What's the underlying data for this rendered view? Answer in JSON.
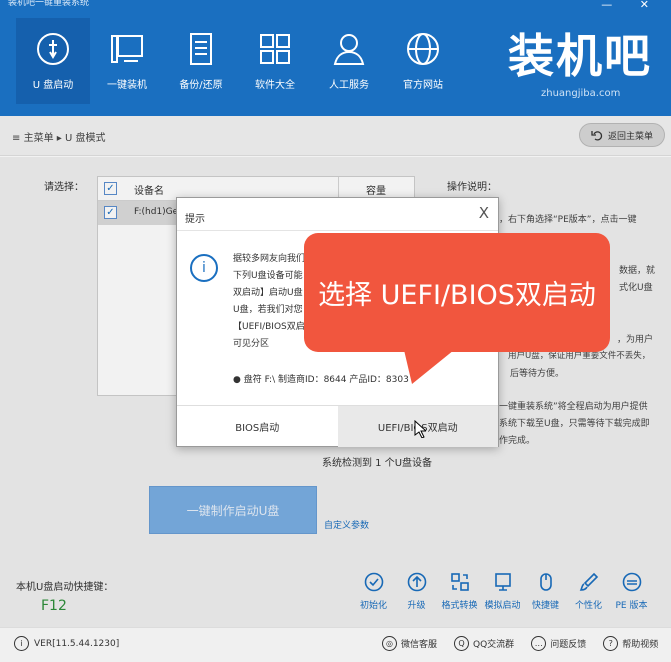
{
  "window": {
    "title": "装机吧一键重装系统",
    "controls": "— ✕"
  },
  "nav": [
    {
      "label": "U 盘启动",
      "icon": "usb-icon",
      "active": true
    },
    {
      "label": "一键装机",
      "icon": "computer-icon"
    },
    {
      "label": "备份/还原",
      "icon": "document-icon"
    },
    {
      "label": "软件大全",
      "icon": "apps-grid-icon"
    },
    {
      "label": "人工服务",
      "icon": "person-icon"
    },
    {
      "label": "官方网站",
      "icon": "globe-icon"
    }
  ],
  "logo": {
    "text": "装机吧",
    "url": "zhuangjiba.com"
  },
  "breadcrumb": {
    "menu_icon": "≡",
    "home": "主菜单",
    "sep": "▸",
    "current": "U 盘模式"
  },
  "back_button": "返回主菜单",
  "device_panel": {
    "select_label": "请选择：",
    "headers": {
      "name": "设备名",
      "capacity": "容量"
    },
    "row_name": "F:(hd1)Ge"
  },
  "instructions": {
    "title": "操作说明：",
    "lines": [
      "，右下角选择“PE版本”，点击一键",
      "数据，就",
      "式化U盘",
      "，为用户",
      "，为用户",
      "一键重装系统”将全程启动为用户提供",
      "系统下载至U盘，只需等待下载完成即",
      "作完成。"
    ],
    "partial_lines": [
      "用户U盘，保证用户重要文件不丢失，",
      "后等待方便。"
    ]
  },
  "detected": "系统检测到 1 个U盘设备",
  "make_button": "一键制作启动U盘",
  "custom_params": "自定义参数",
  "hotkey": {
    "label": "本机U盘启动快捷键：",
    "key": "F12"
  },
  "tools": [
    {
      "label": "初始化",
      "icon": "check-circle-icon"
    },
    {
      "label": "升级",
      "icon": "upload-icon"
    },
    {
      "label": "格式转换",
      "icon": "convert-icon"
    },
    {
      "label": "模拟启动",
      "icon": "monitor-icon"
    },
    {
      "label": "快捷键",
      "icon": "mouse-icon"
    },
    {
      "label": "个性化",
      "icon": "brush-icon"
    },
    {
      "label": "PE 版本",
      "icon": "pe-icon"
    }
  ],
  "footer": {
    "version": "VER[11.5.44.1230]",
    "links": [
      {
        "label": "微信客服",
        "icon": "wechat-icon"
      },
      {
        "label": "QQ交流群",
        "icon": "qq-icon"
      },
      {
        "label": "问题反馈",
        "icon": "feedback-icon"
      },
      {
        "label": "帮助视频",
        "icon": "help-icon"
      }
    ]
  },
  "dialog": {
    "title": "提示",
    "close": "X",
    "lines": [
      "据较多网友向我们",
      "下列U盘设备可能",
      "双启动】启动U盘",
      "U盘，若我们对您",
      "【UEFI/BIOS双启",
      "可见分区"
    ],
    "disk_info": "● 盘符 F:\\ 制造商ID：8644 产品ID：8303",
    "btn_bios": "BIOS启动",
    "btn_uefi": "UEFI/BIOS双启动"
  },
  "callout": "选择 UEFI/BIOS双启动"
}
